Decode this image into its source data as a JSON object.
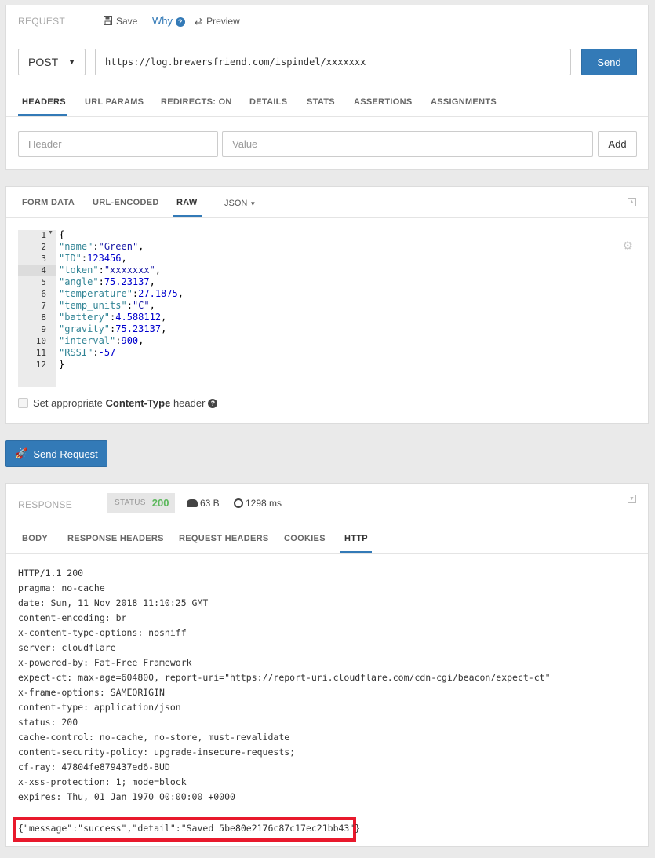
{
  "request": {
    "title": "REQUEST",
    "save_label": "Save",
    "why_label": "Why",
    "preview_label": "Preview",
    "method": "POST",
    "url": "https://log.brewersfriend.com/ispindel/xxxxxxx",
    "send_label": "Send",
    "tabs": [
      "HEADERS",
      "URL PARAMS",
      "REDIRECTS: ON",
      "DETAILS",
      "STATS",
      "ASSERTIONS",
      "ASSIGNMENTS"
    ],
    "header_placeholder": "Header",
    "value_placeholder": "Value",
    "add_label": "Add"
  },
  "body_editor": {
    "tabs": [
      "FORM DATA",
      "URL-ENCODED",
      "RAW",
      "JSON"
    ],
    "line_numbers": [
      "1",
      "2",
      "3",
      "4",
      "5",
      "6",
      "7",
      "8",
      "9",
      "10",
      "11",
      "12"
    ],
    "lines": [
      {
        "key": "",
        "value": "",
        "plain": "{"
      },
      {
        "key": "\"name\"",
        "value": "\"Green\"",
        "tail": ","
      },
      {
        "key": "\"ID\"",
        "value": "123456",
        "tail": ","
      },
      {
        "key": "\"token\"",
        "value": "\"xxxxxxx\"",
        "tail": ","
      },
      {
        "key": "\"angle\"",
        "value": "75.23137",
        "tail": ","
      },
      {
        "key": "\"temperature\"",
        "value": "27.1875",
        "tail": ","
      },
      {
        "key": "\"temp_units\"",
        "value": "\"C\"",
        "tail": ","
      },
      {
        "key": "\"battery\"",
        "value": "4.588112",
        "tail": ","
      },
      {
        "key": "\"gravity\"",
        "value": "75.23137",
        "tail": ","
      },
      {
        "key": "\"interval\"",
        "value": "900",
        "tail": ","
      },
      {
        "key": "\"RSSI\"",
        "value": "-57",
        "tail": ""
      },
      {
        "key": "",
        "value": "",
        "plain": "}"
      }
    ],
    "content_type_label_pre": "Set appropriate ",
    "content_type_label_bold": "Content-Type",
    "content_type_label_post": " header",
    "content_type_checked": false
  },
  "send_request_label": "Send Request",
  "response": {
    "title": "RESPONSE",
    "status_label": "STATUS",
    "status_code": "200",
    "size": "63 B",
    "time": "1298 ms",
    "tabs": [
      "BODY",
      "RESPONSE HEADERS",
      "REQUEST HEADERS",
      "COOKIES",
      "HTTP"
    ],
    "http_lines": [
      "HTTP/1.1 200",
      "pragma: no-cache",
      "date: Sun, 11 Nov 2018 11:10:25 GMT",
      "content-encoding: br",
      "x-content-type-options: nosniff",
      "server: cloudflare",
      "x-powered-by: Fat-Free Framework",
      "expect-ct: max-age=604800, report-uri=\"https://report-uri.cloudflare.com/cdn-cgi/beacon/expect-ct\"",
      "x-frame-options: SAMEORIGIN",
      "content-type: application/json",
      "status: 200",
      "cache-control: no-cache, no-store, must-revalidate",
      "content-security-policy: upgrade-insecure-requests;",
      "cf-ray: 47804fe879437ed6-BUD",
      "x-xss-protection: 1; mode=block",
      "expires: Thu, 01 Jan 1970 00:00:00 +0000"
    ],
    "body": "{\"message\":\"success\",\"detail\":\"Saved 5be80e2176c87c17ec21bb43\"}"
  },
  "colors": {
    "accent": "#337ab7",
    "status_ok": "#5cb85c",
    "highlight_box": "#e8192c"
  }
}
